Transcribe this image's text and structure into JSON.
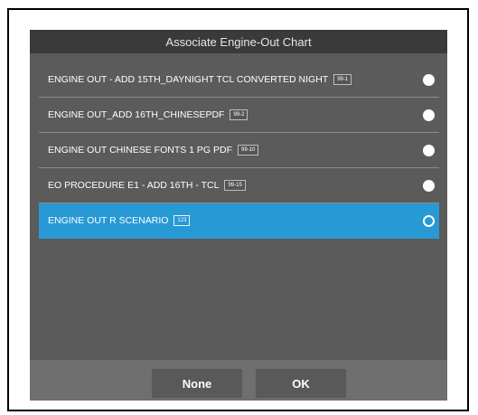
{
  "dialog": {
    "title": "Associate Engine-Out Chart"
  },
  "charts": [
    {
      "label": "ENGINE OUT - ADD 15TH_DAYNIGHT TCL CONVERTED NIGHT",
      "badge": "99-1",
      "selected": false
    },
    {
      "label": "ENGINE OUT_ADD 16TH_CHINESEPDF",
      "badge": "99-2",
      "selected": false
    },
    {
      "label": "ENGINE OUT CHINESE FONTS 1 PG PDF",
      "badge": "99-10",
      "selected": false
    },
    {
      "label": "EO PROCEDURE E1 - ADD 16TH - TCL",
      "badge": "99-15",
      "selected": false
    },
    {
      "label": "ENGINE OUT R SCENARIO",
      "badge": "123",
      "selected": true
    }
  ],
  "buttons": {
    "none_label": "None",
    "ok_label": "OK"
  },
  "colors": {
    "dialog_bg": "#5b5b5b",
    "header_bg": "#3a3a3a",
    "selected_row": "#2799d4",
    "footer_bg": "#6f6f6f",
    "button_bg": "#595959"
  }
}
